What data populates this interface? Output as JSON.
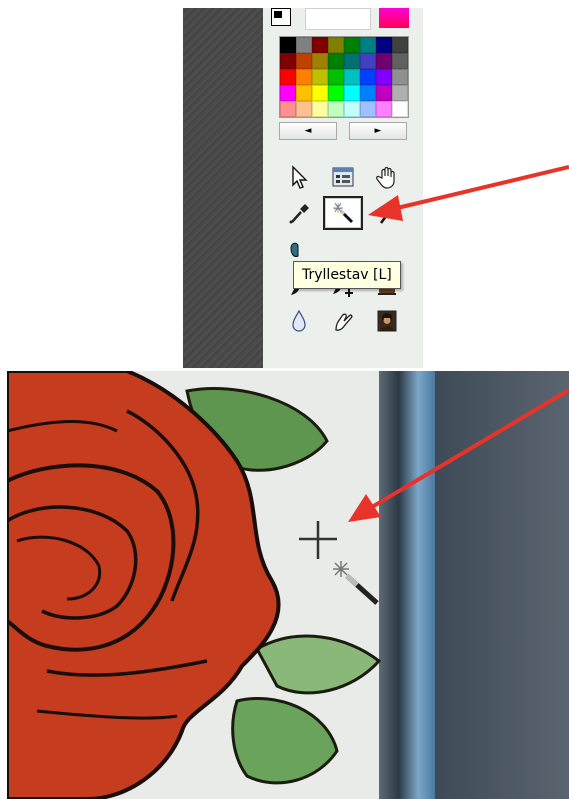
{
  "tooltip": {
    "text": "Tryllestav [L]"
  },
  "palette": {
    "colors": [
      "#000000",
      "#808080",
      "#800000",
      "#808000",
      "#008000",
      "#008080",
      "#000080",
      "#404040",
      "#800000",
      "#c04000",
      "#a08000",
      "#008000",
      "#007070",
      "#4040c0",
      "#700070",
      "#606060",
      "#ff0000",
      "#ff8000",
      "#c0c000",
      "#00c000",
      "#00c0c0",
      "#0040ff",
      "#8000ff",
      "#909090",
      "#ff00ff",
      "#ffc000",
      "#ffff00",
      "#00ff00",
      "#00ffff",
      "#0080ff",
      "#c000c0",
      "#b0b0b0",
      "#ff9090",
      "#ffc090",
      "#ffffa0",
      "#c0ffc0",
      "#c0ffff",
      "#a0c0ff",
      "#ff80ff",
      "#ffffff"
    ],
    "prev_label": "◄",
    "next_label": "►"
  },
  "tools": [
    {
      "id": "pointer",
      "icon": "arrow-pointer-icon"
    },
    {
      "id": "window",
      "icon": "window-list-icon"
    },
    {
      "id": "hand",
      "icon": "hand-icon"
    },
    {
      "id": "eyedropper",
      "icon": "eyedropper-icon"
    },
    {
      "id": "magic-wand",
      "icon": "magic-wand-icon",
      "selected": true
    },
    {
      "id": "line",
      "icon": "line-icon"
    },
    {
      "id": "paint-bucket",
      "icon": "paint-bucket-icon"
    },
    {
      "id": "eraser",
      "icon": "eraser-icon"
    },
    {
      "id": "blank",
      "icon": "none"
    },
    {
      "id": "brush",
      "icon": "brush-icon"
    },
    {
      "id": "brush-plus",
      "icon": "brush-plus-icon"
    },
    {
      "id": "stamp",
      "icon": "stamp-icon"
    },
    {
      "id": "drop",
      "icon": "water-drop-icon"
    },
    {
      "id": "smudge",
      "icon": "smudge-hand-icon"
    },
    {
      "id": "portrait",
      "icon": "portrait-icon"
    }
  ],
  "colors": {
    "arrow": "#e8332a",
    "tooltip_bg": "#ffffe1",
    "rose": "#c43a1d",
    "leaf": "#5f9a52"
  }
}
